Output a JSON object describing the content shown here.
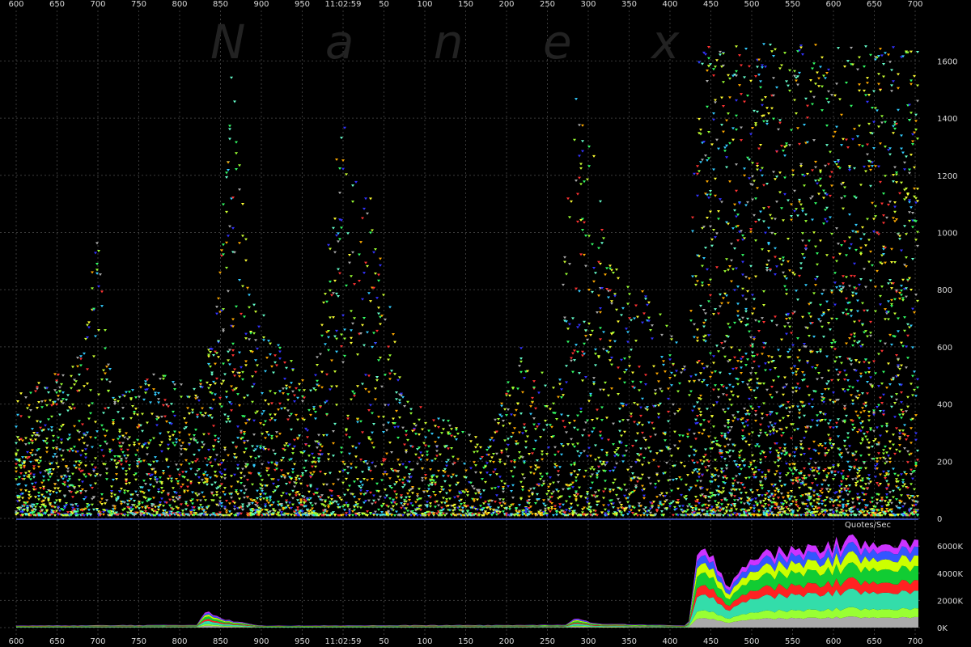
{
  "chart_data": [
    {
      "type": "scatter",
      "panel": "upper",
      "watermark": "N a n e x",
      "time_label": "11:02:59",
      "x_tick_labels": [
        "600",
        "650",
        "700",
        "750",
        "800",
        "850",
        "900",
        "950",
        "11:02:59",
        "50",
        "100",
        "150",
        "200",
        "250",
        "300",
        "350",
        "400",
        "450",
        "500",
        "550",
        "600",
        "650",
        "700"
      ],
      "y_tick_labels": [
        "0",
        "200",
        "400",
        "600",
        "800",
        "1000",
        "1200",
        "1400",
        "1600"
      ],
      "ylim": [
        0,
        1700
      ],
      "grid": true,
      "legend": "none",
      "colors": [
        "#33ff66",
        "#66ffcc",
        "#99ff33",
        "#ccff33",
        "#ffff33",
        "#3333ff",
        "#ff3333",
        "#aaaaaa",
        "#33ccff",
        "#ffaa00"
      ],
      "density_profile": [
        {
          "x": 0.0,
          "h": 420,
          "d": 0.55
        },
        {
          "x": 0.07,
          "h": 560,
          "d": 0.5
        },
        {
          "x": 0.09,
          "h": 1050,
          "d": 0.35
        },
        {
          "x": 0.11,
          "h": 400,
          "d": 0.45
        },
        {
          "x": 0.15,
          "h": 520,
          "d": 0.45
        },
        {
          "x": 0.2,
          "h": 450,
          "d": 0.4
        },
        {
          "x": 0.22,
          "h": 650,
          "d": 0.55
        },
        {
          "x": 0.24,
          "h": 1600,
          "d": 0.55
        },
        {
          "x": 0.26,
          "h": 800,
          "d": 0.55
        },
        {
          "x": 0.29,
          "h": 600,
          "d": 0.45
        },
        {
          "x": 0.33,
          "h": 450,
          "d": 0.5
        },
        {
          "x": 0.36,
          "h": 1400,
          "d": 0.4
        },
        {
          "x": 0.4,
          "h": 1050,
          "d": 0.4
        },
        {
          "x": 0.43,
          "h": 420,
          "d": 0.4
        },
        {
          "x": 0.47,
          "h": 350,
          "d": 0.35
        },
        {
          "x": 0.52,
          "h": 260,
          "d": 0.3
        },
        {
          "x": 0.56,
          "h": 600,
          "d": 0.4
        },
        {
          "x": 0.6,
          "h": 450,
          "d": 0.3
        },
        {
          "x": 0.62,
          "h": 1650,
          "d": 0.55
        },
        {
          "x": 0.66,
          "h": 900,
          "d": 0.45
        },
        {
          "x": 0.72,
          "h": 700,
          "d": 0.35
        },
        {
          "x": 0.745,
          "h": 500,
          "d": 0.25
        },
        {
          "x": 0.755,
          "h": 1650,
          "d": 0.85
        },
        {
          "x": 1.0,
          "h": 1650,
          "d": 0.85
        }
      ]
    },
    {
      "type": "area",
      "panel": "lower",
      "title": "Quotes/Sec",
      "y_tick_labels": [
        "0K",
        "2000K",
        "4000K",
        "6000K"
      ],
      "ylim": [
        0,
        7000
      ],
      "series_colors": [
        "#aaaaaa",
        "#99ff33",
        "#33ddaa",
        "#ff2222",
        "#11cc33",
        "#ccff00",
        "#3355ff",
        "#cc33ff"
      ],
      "total_profile": [
        {
          "x": 0.0,
          "v": 150
        },
        {
          "x": 0.2,
          "v": 200
        },
        {
          "x": 0.21,
          "v": 1300
        },
        {
          "x": 0.23,
          "v": 600
        },
        {
          "x": 0.27,
          "v": 150
        },
        {
          "x": 0.61,
          "v": 200
        },
        {
          "x": 0.62,
          "v": 800
        },
        {
          "x": 0.64,
          "v": 300
        },
        {
          "x": 0.74,
          "v": 150
        },
        {
          "x": 0.745,
          "v": 200
        },
        {
          "x": 0.755,
          "v": 5200
        },
        {
          "x": 0.77,
          "v": 5600
        },
        {
          "x": 0.79,
          "v": 3000
        },
        {
          "x": 0.81,
          "v": 5000
        },
        {
          "x": 0.85,
          "v": 5600
        },
        {
          "x": 0.9,
          "v": 6000
        },
        {
          "x": 0.95,
          "v": 6500
        },
        {
          "x": 1.0,
          "v": 6000
        }
      ],
      "series_shares": [
        0.12,
        0.1,
        0.2,
        0.12,
        0.16,
        0.12,
        0.1,
        0.08
      ]
    }
  ]
}
